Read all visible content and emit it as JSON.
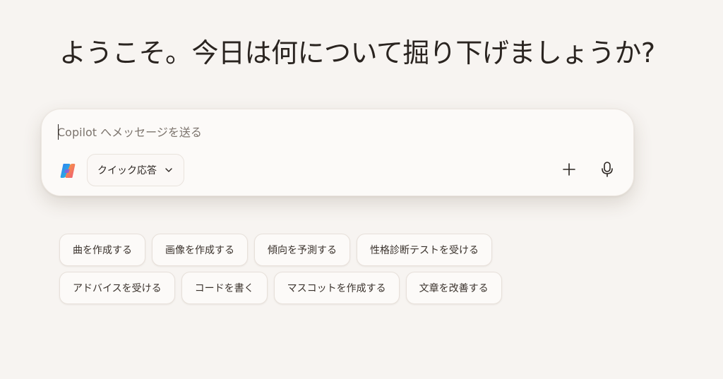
{
  "greeting": "ようこそ。今日は何について掘り下げましょうか?",
  "composer": {
    "placeholder": "Copilot へメッセージを送る",
    "value": "",
    "mode_label": "クイック応答",
    "logo_icon": "copilot-logo-icon",
    "add_icon": "plus-icon",
    "mic_icon": "microphone-icon"
  },
  "suggestions": {
    "row1": [
      "曲を作成する",
      "画像を作成する",
      "傾向を予測する",
      "性格診断テストを受ける"
    ],
    "row2": [
      "アドバイスを受ける",
      "コードを書く",
      "マスコットを作成する",
      "文章を改善する"
    ]
  },
  "colors": {
    "background": "#f7f4f1",
    "card": "#fcfaf8",
    "text": "#2b2521",
    "muted_text": "#7c746d"
  }
}
